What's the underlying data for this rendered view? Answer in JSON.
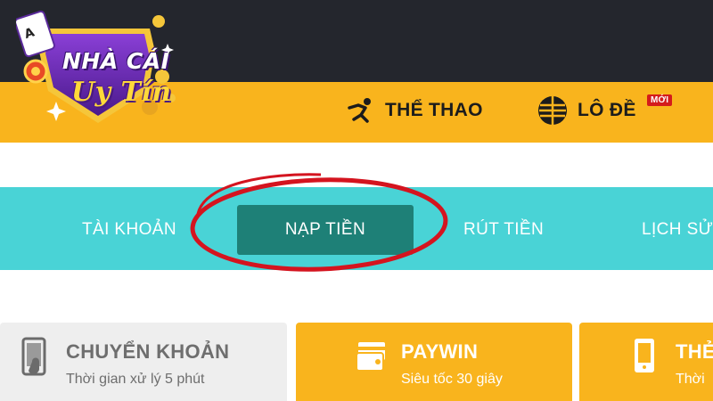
{
  "logo": {
    "line1": "NHÀ CÁI",
    "line2": "Uy Tín"
  },
  "nav": {
    "sports_label": "THỂ THAO",
    "lode_label": "LÔ ĐỀ",
    "lode_badge": "MỚI"
  },
  "tabs": {
    "account": "TÀI KHOẢN",
    "deposit": "NẠP TIỀN",
    "withdraw": "RÚT TIỀN",
    "history": "LỊCH SỬ"
  },
  "methods": {
    "transfer_title": "CHUYỂN KHOẢN",
    "transfer_sub": "Thời gian xử lý 5 phút",
    "paywin_title": "PAYWIN",
    "paywin_sub": "Siêu tốc 30 giây",
    "card_title": "THẺ",
    "card_sub": "Thời"
  },
  "colors": {
    "topbar": "#24262d",
    "nav_yellow": "#f9b41d",
    "tab_teal": "#49d3d6",
    "active_tab": "#1e8077",
    "highlight_ring": "#d4141f",
    "badge_red": "#d41b1b"
  },
  "icons": {
    "sports": "runner-icon",
    "lode": "ball-icon",
    "transfer": "phone-hand-icon",
    "paywin": "wallet-card-icon",
    "card": "mobile-card-icon"
  }
}
